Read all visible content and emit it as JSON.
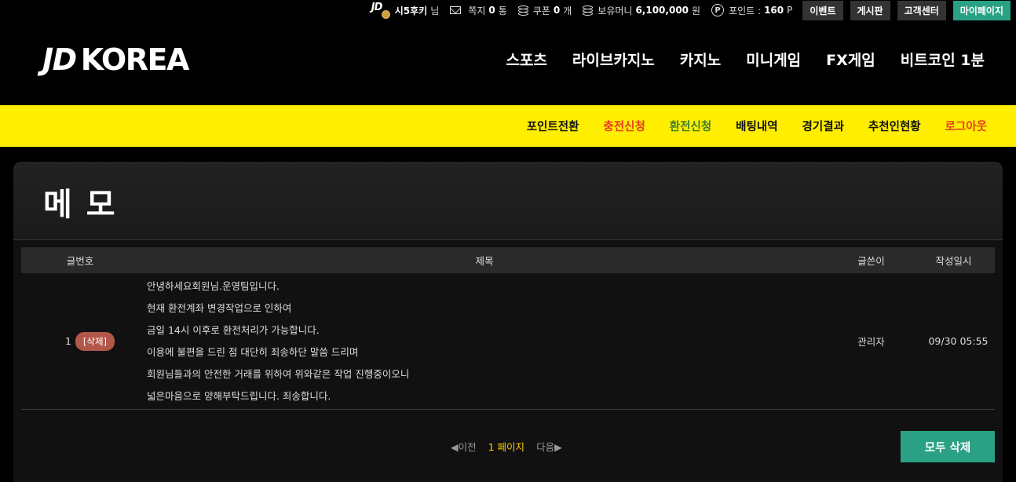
{
  "topbar": {
    "username": "시5후키",
    "honorific": "님",
    "memo_label": "쪽지",
    "memo_count": "0",
    "memo_unit": "통",
    "coupon_label": "쿠폰",
    "coupon_count": "0",
    "coupon_unit": "개",
    "money_label": "보유머니",
    "money_value": "6,100,000",
    "money_unit": "원",
    "point_label": "포인트 :",
    "point_value": "160",
    "point_unit": "P",
    "p_glyph": "P",
    "buttons": {
      "event": "이벤트",
      "board": "게시판",
      "support": "고객센터",
      "mypage": "마이페이지"
    }
  },
  "header": {
    "logo_jd": "JD",
    "logo_korea": "KOREA",
    "nav": [
      "스포츠",
      "라이브카지노",
      "카지노",
      "미니게임",
      "FX게임",
      "비트코인 1분"
    ]
  },
  "subnav": {
    "items": [
      {
        "label": "포인트전환",
        "color": "#111111"
      },
      {
        "label": "충전신청",
        "color": "#e63b1e"
      },
      {
        "label": "환전신청",
        "color": "#3e7d2c"
      },
      {
        "label": "배팅내역",
        "color": "#111111"
      },
      {
        "label": "경기결과",
        "color": "#111111"
      },
      {
        "label": "추천인현황",
        "color": "#111111"
      },
      {
        "label": "로그아웃",
        "color": "#e63b1e"
      }
    ]
  },
  "page": {
    "title": "메 모",
    "table": {
      "headers": {
        "no": "글번호",
        "title": "제목",
        "writer": "글쓴이",
        "date": "작성일시"
      },
      "rows": [
        {
          "no": "1",
          "delete_label": "[삭제]",
          "lines": [
            "안녕하세요회원님.운영팀입니다.",
            "현재 환전계좌 변경작업으로 인하여",
            "금일 14시 이후로 환전처리가 가능합니다.",
            "이용에 불편을 드린 점 대단히 죄송하단 말씀 드리며",
            "회원님들과의 안전한 거래를 위하여 위와같은 작업 진행중이오니",
            "넓은마음으로 양해부탁드립니다. 죄송합니다."
          ],
          "writer": "관리자",
          "date": "09/30 05:55"
        }
      ]
    },
    "pager": {
      "prev": "◀이전",
      "current": "1 페이지",
      "next": "다음▶"
    },
    "delete_all": "모두 삭제"
  },
  "colors": {
    "accent_yellow": "#ffee00",
    "accent_green": "#2aa184",
    "delete_badge": "#b3574a",
    "pager_current": "#ffd200"
  }
}
